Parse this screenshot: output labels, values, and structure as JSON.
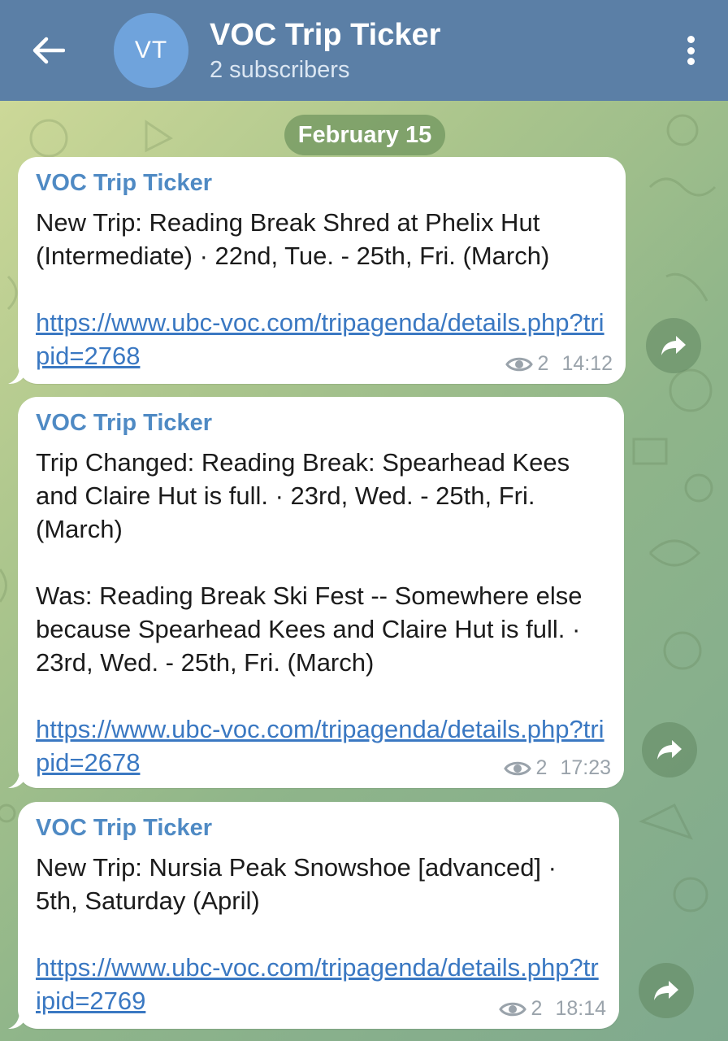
{
  "header": {
    "avatar_initials": "VT",
    "title": "VOC Trip Ticker",
    "subtitle": "2 subscribers",
    "colors": {
      "bar": "#5b7fa6",
      "avatar": "#6fa3dc"
    },
    "icons": {
      "back": "arrow-left-icon",
      "menu": "more-vertical-icon"
    }
  },
  "date_separator": "February 15",
  "messages": [
    {
      "sender": "VOC Trip Ticker",
      "text": "New Trip: Reading Break Shred at Phelix Hut (Intermediate) · 22nd, Tue. - 25th, Fri. (March)",
      "link": "https://www.ubc-voc.com/tripagenda/details.php?tripid=2768",
      "views": "2",
      "time": "14:12"
    },
    {
      "sender": "VOC Trip Ticker",
      "text": "Trip Changed: Reading Break: Spearhead Kees and Claire Hut is full. · 23rd, Wed. - 25th, Fri. (March)\n\nWas: Reading Break Ski Fest -- Somewhere else because Spearhead Kees and Claire Hut is full. · 23rd, Wed. - 25th, Fri. (March)",
      "link": "https://www.ubc-voc.com/tripagenda/details.php?tripid=2678",
      "views": "2",
      "time": "17:23"
    },
    {
      "sender": "VOC Trip Ticker",
      "text": "New Trip: Nursia Peak Snowshoe [advanced] · 5th, Saturday (April)",
      "link": "https://www.ubc-voc.com/tripagenda/details.php?tripid=2769",
      "views": "2",
      "time": "18:14"
    }
  ],
  "icons": {
    "views": "eye-icon",
    "share": "share-arrow-icon"
  }
}
